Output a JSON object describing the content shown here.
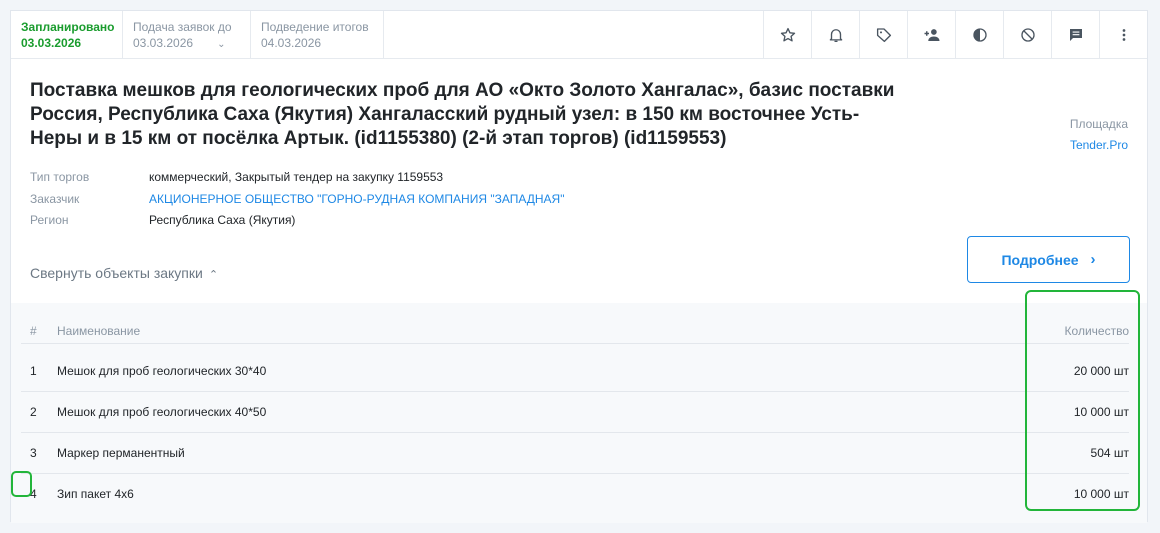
{
  "stages": [
    {
      "label": "Запланировано",
      "value": "03.03.2026",
      "active": true
    },
    {
      "label": "Подача заявок до",
      "value": "03.03.2026"
    },
    {
      "label": "Подведение итогов",
      "value": "04.03.2026"
    }
  ],
  "toolbar_icons": [
    "star-icon",
    "bell-icon",
    "tag-icon",
    "add-person-icon",
    "contrast-icon",
    "block-icon",
    "comment-icon",
    "more-vertical-icon"
  ],
  "tender": {
    "title": "Поставка мешков для геологических проб для АО «Окто Золото Хангалас», базис поставки Россия, Республика Саха (Якутия) Хангаласский рудный узел: в 150 км восточнее Усть-Неры и в 15 км от посёлка Артык. (id1155380) (2-й этап торгов) (id1159553)",
    "type_label": "Тип торгов",
    "type_value": "коммерческий, Закрытый тендер на закупку 1159553",
    "customer_label": "Заказчик",
    "customer_value": "АКЦИОНЕРНОЕ ОБЩЕСТВО \"ГОРНО-РУДНАЯ КОМПАНИЯ \"ЗАПАДНАЯ\"",
    "region_label": "Регион",
    "region_value": "Республика Саха (Якутия)",
    "platform_label": "Площадка",
    "platform_value": "Tender.Pro"
  },
  "collapse_label": "Свернуть объекты закупки",
  "more_button": "Подробнее",
  "items_table": {
    "headers": {
      "num": "#",
      "name": "Наименование",
      "qty": "Количество"
    },
    "rows": [
      {
        "num": "1",
        "name": "Мешок для проб геологических 30*40",
        "qty": "20 000 шт"
      },
      {
        "num": "2",
        "name": "Мешок для проб геологических 40*50",
        "qty": "10 000 шт"
      },
      {
        "num": "3",
        "name": "Маркер перманентный",
        "qty": "504 шт"
      },
      {
        "num": "4",
        "name": "Зип пакет 4x6",
        "qty": "10 000 шт"
      }
    ]
  },
  "colors": {
    "accent": "#1e88e5",
    "active_stage": "#1a9c2e",
    "highlight": "#22b53a"
  }
}
